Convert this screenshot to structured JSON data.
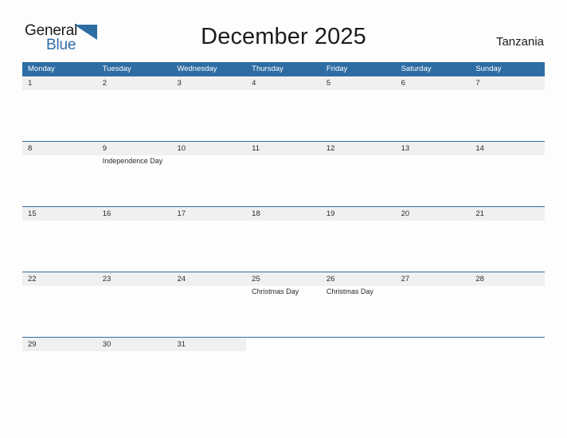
{
  "logo": {
    "text_primary": "General",
    "text_secondary": "Blue",
    "mark": "triangle-flag-icon",
    "primary_color": "#1a1a1a",
    "secondary_color": "#2e6da4"
  },
  "header": {
    "title": "December 2025",
    "country": "Tanzania"
  },
  "theme": {
    "header_blue": "#2e6da4",
    "band_gray": "#f0f0f0",
    "text_dark": "#2b2b2b",
    "page_background": "#fdfdfd"
  },
  "calendar": {
    "month": "December",
    "year": "2025",
    "weekday_headers": [
      "Monday",
      "Tuesday",
      "Wednesday",
      "Thursday",
      "Friday",
      "Saturday",
      "Sunday"
    ],
    "weeks": [
      [
        {
          "day": "1",
          "events": []
        },
        {
          "day": "2",
          "events": []
        },
        {
          "day": "3",
          "events": []
        },
        {
          "day": "4",
          "events": []
        },
        {
          "day": "5",
          "events": []
        },
        {
          "day": "6",
          "events": []
        },
        {
          "day": "7",
          "events": []
        }
      ],
      [
        {
          "day": "8",
          "events": []
        },
        {
          "day": "9",
          "events": [
            "Independence Day"
          ]
        },
        {
          "day": "10",
          "events": []
        },
        {
          "day": "11",
          "events": []
        },
        {
          "day": "12",
          "events": []
        },
        {
          "day": "13",
          "events": []
        },
        {
          "day": "14",
          "events": []
        }
      ],
      [
        {
          "day": "15",
          "events": []
        },
        {
          "day": "16",
          "events": []
        },
        {
          "day": "17",
          "events": []
        },
        {
          "day": "18",
          "events": []
        },
        {
          "day": "19",
          "events": []
        },
        {
          "day": "20",
          "events": []
        },
        {
          "day": "21",
          "events": []
        }
      ],
      [
        {
          "day": "22",
          "events": []
        },
        {
          "day": "23",
          "events": []
        },
        {
          "day": "24",
          "events": []
        },
        {
          "day": "25",
          "events": [
            "Christmas Day"
          ]
        },
        {
          "day": "26",
          "events": [
            "Christmas Day"
          ]
        },
        {
          "day": "27",
          "events": []
        },
        {
          "day": "28",
          "events": []
        }
      ],
      [
        {
          "day": "29",
          "events": []
        },
        {
          "day": "30",
          "events": []
        },
        {
          "day": "31",
          "events": []
        },
        {
          "day": "",
          "events": []
        },
        {
          "day": "",
          "events": []
        },
        {
          "day": "",
          "events": []
        },
        {
          "day": "",
          "events": []
        }
      ]
    ]
  }
}
